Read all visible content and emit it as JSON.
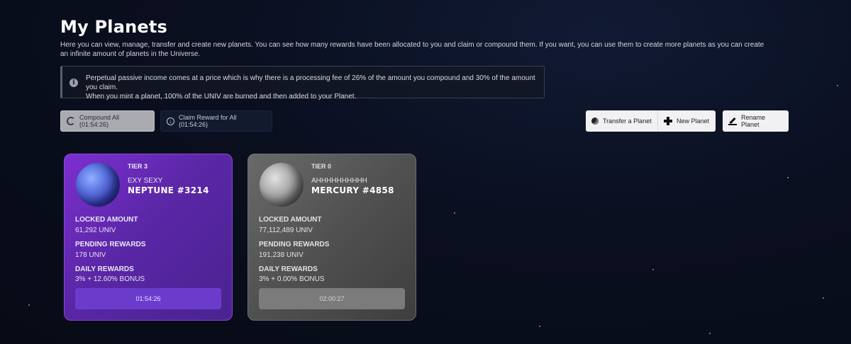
{
  "page": {
    "title": "My Planets",
    "intro": "Here you can view, manage, transfer and create new planets. You can see how many rewards have been allocated to you and claim or compound them. If you want, you can use them to create more planets as you can create an infinite amount of planets in the Universe.",
    "notice_line1": "Perpetual passive income comes at a price which is why there is a processing fee of 26% of the amount you compound and 30% of the amount you claim.",
    "notice_line2": "When you mint a planet, 100% of the UNIV are burned and then added to your Planet."
  },
  "actions": {
    "compound_all": "Compound All (01:54:26)",
    "claim_all": "Claim Reward for All (01:54:26)",
    "transfer": "Transfer a Planet",
    "new_planet": "New Planet",
    "rename": "Rename Planet"
  },
  "labels": {
    "locked": "LOCKED AMOUNT",
    "pending": "PENDING REWARDS",
    "daily": "DAILY REWARDS"
  },
  "planets": [
    {
      "tier": "TIER 3",
      "nickname": "EXY SEXY",
      "name": "NEPTUNE #3214",
      "locked": "61,292 UNIV",
      "pending": "178 UNIV",
      "daily": "3% + 12.60% BONUS",
      "timer": "01:54:26",
      "color": "#6b2fc4"
    },
    {
      "tier": "TIER 0",
      "nickname": "AHHHHHHHHHH",
      "name": "MERCURY #4858",
      "locked": "77,112,489 UNIV",
      "pending": "191,238 UNIV",
      "daily": "3% + 0.00% BONUS",
      "timer": "02:00:27",
      "color": "#555555"
    }
  ]
}
